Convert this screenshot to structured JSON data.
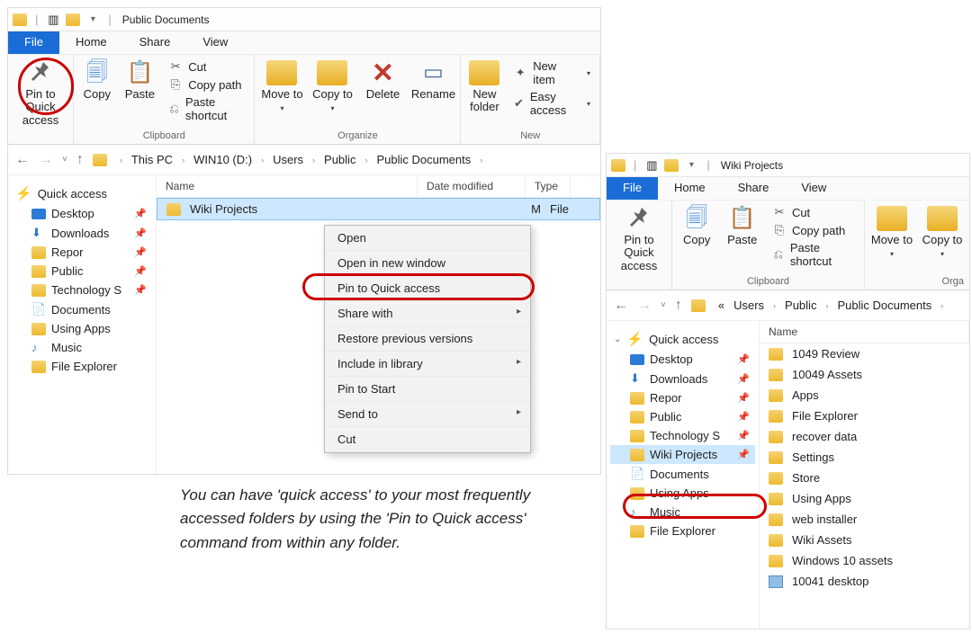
{
  "window1": {
    "title": "Public Documents",
    "tabs": {
      "file": "File",
      "home": "Home",
      "share": "Share",
      "view": "View"
    },
    "ribbon": {
      "pin": "Pin to Quick access",
      "copy": "Copy",
      "paste": "Paste",
      "cut": "Cut",
      "copypath": "Copy path",
      "pasteshortcut": "Paste shortcut",
      "clipboard_label": "Clipboard",
      "moveto": "Move to",
      "copyto": "Copy to",
      "delete": "Delete",
      "rename": "Rename",
      "organize_label": "Organize",
      "newfolder": "New folder",
      "newitem": "New item",
      "easyaccess": "Easy access",
      "new_label": "New"
    },
    "breadcrumbs": [
      "This PC",
      "WIN10 (D:)",
      "Users",
      "Public",
      "Public Documents"
    ],
    "columns": {
      "name": "Name",
      "date": "Date modified",
      "type": "Type"
    },
    "row": {
      "name": "Wiki Projects",
      "date_suffix": "M",
      "type": "File"
    },
    "sidebar": {
      "quickaccess": "Quick access",
      "items": [
        {
          "label": "Desktop",
          "pin": true,
          "icon": "desktop"
        },
        {
          "label": "Downloads",
          "pin": true,
          "icon": "downloads"
        },
        {
          "label": "Repor",
          "pin": true,
          "icon": "folder"
        },
        {
          "label": "Public",
          "pin": true,
          "icon": "folder"
        },
        {
          "label": "Technology S",
          "pin": true,
          "icon": "folder"
        },
        {
          "label": "Documents",
          "pin": false,
          "icon": "documents"
        },
        {
          "label": "Using Apps",
          "pin": false,
          "icon": "folder"
        },
        {
          "label": "Music",
          "pin": false,
          "icon": "music"
        },
        {
          "label": "File Explorer",
          "pin": false,
          "icon": "folder"
        }
      ]
    },
    "contextmenu": [
      {
        "label": "Open"
      },
      {
        "label": "Open in new window"
      },
      {
        "label": "Pin to Quick access"
      },
      {
        "label": "Share with",
        "sub": true
      },
      {
        "label": "Restore previous versions"
      },
      {
        "label": "Include in library",
        "sub": true
      },
      {
        "label": "Pin to Start"
      },
      {
        "label": "Send to",
        "sub": true
      },
      {
        "label": "Cut"
      }
    ]
  },
  "window2": {
    "title": "Wiki Projects",
    "tabs": {
      "file": "File",
      "home": "Home",
      "share": "Share",
      "view": "View"
    },
    "ribbon": {
      "pin": "Pin to Quick access",
      "copy": "Copy",
      "paste": "Paste",
      "cut": "Cut",
      "copypath": "Copy path",
      "pasteshortcut": "Paste shortcut",
      "clipboard_label": "Clipboard",
      "moveto": "Move to",
      "copyto": "Copy to",
      "organize_label": "Orga"
    },
    "breadcrumbs_prefix": "«",
    "breadcrumbs": [
      "Users",
      "Public",
      "Public Documents"
    ],
    "columns": {
      "name": "Name"
    },
    "sidebar": {
      "quickaccess": "Quick access",
      "items": [
        {
          "label": "Desktop",
          "pin": true,
          "icon": "desktop"
        },
        {
          "label": "Downloads",
          "pin": true,
          "icon": "downloads"
        },
        {
          "label": "Repor",
          "pin": true,
          "icon": "folder"
        },
        {
          "label": "Public",
          "pin": true,
          "icon": "folder"
        },
        {
          "label": "Technology S",
          "pin": true,
          "icon": "folder"
        },
        {
          "label": "Wiki Projects",
          "pin": true,
          "icon": "folder",
          "sel": true
        },
        {
          "label": "Documents",
          "pin": false,
          "icon": "documents"
        },
        {
          "label": "Using Apps",
          "pin": false,
          "icon": "folder"
        },
        {
          "label": "Music",
          "pin": false,
          "icon": "music"
        },
        {
          "label": "File Explorer",
          "pin": false,
          "icon": "folder"
        }
      ]
    },
    "files": [
      "1049 Review",
      "10049 Assets",
      "Apps",
      "File Explorer",
      "recover data",
      "Settings",
      "Store",
      "Using Apps",
      "web installer",
      "Wiki Assets",
      "Windows 10 assets",
      "10041 desktop"
    ]
  },
  "caption": "You can have 'quick access' to your most frequently accessed folders by using the 'Pin to Quick access' command from within any folder."
}
